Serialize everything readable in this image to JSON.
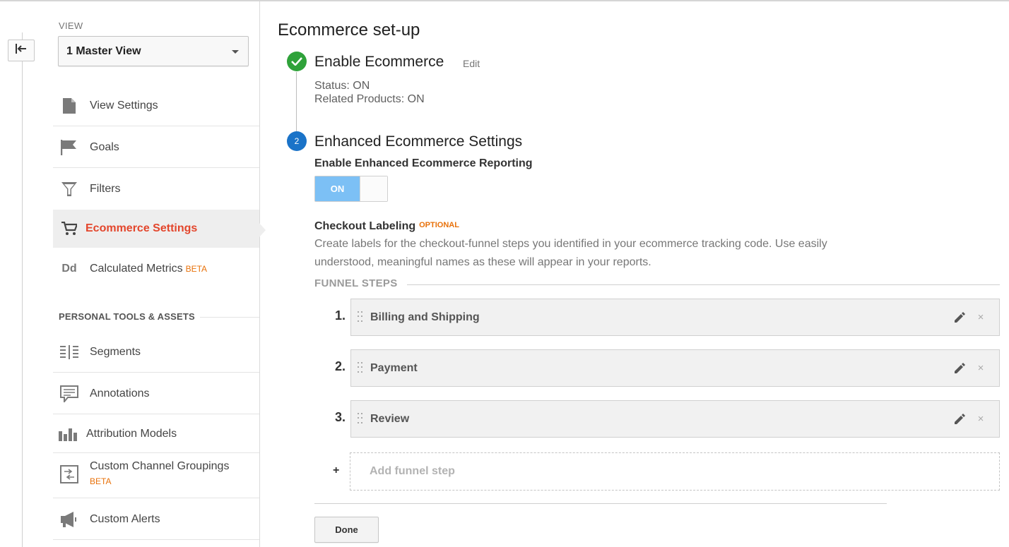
{
  "sidebar": {
    "view_label": "VIEW",
    "view_select": "1 Master View",
    "items": [
      {
        "label": "View Settings",
        "icon": "page-icon"
      },
      {
        "label": "Goals",
        "icon": "flag-icon"
      },
      {
        "label": "Filters",
        "icon": "funnel-icon"
      },
      {
        "label": "Ecommerce Settings",
        "icon": "cart-icon",
        "active": true
      },
      {
        "label": "Calculated Metrics",
        "badge": "BETA",
        "icon": "dd-icon"
      }
    ],
    "section_title": "PERSONAL TOOLS & ASSETS",
    "tools": [
      {
        "label": "Segments",
        "icon": "segments-icon"
      },
      {
        "label": "Annotations",
        "icon": "comment-icon"
      },
      {
        "label": "Attribution Models",
        "icon": "bars-icon"
      },
      {
        "label": "Custom Channel Groupings",
        "badge": "BETA",
        "icon": "channel-icon"
      },
      {
        "label": "Custom Alerts",
        "icon": "megaphone-icon"
      }
    ]
  },
  "main": {
    "title": "Ecommerce set-up",
    "step1": {
      "title": "Enable Ecommerce",
      "edit": "Edit",
      "status": "Status: ON",
      "related": "Related Products: ON"
    },
    "step2": {
      "number": "2",
      "title": "Enhanced Ecommerce Settings",
      "enable_label": "Enable Enhanced Ecommerce Reporting",
      "toggle": "ON",
      "checkout_label": "Checkout Labeling",
      "optional": "OPTIONAL",
      "description": "Create labels for the checkout-funnel steps you identified in your ecommerce tracking code. Use easily understood, meaningful names as these will appear in your reports.",
      "funnel_heading": "FUNNEL STEPS",
      "funnel_steps": [
        {
          "num": "1.",
          "label": "Billing and Shipping"
        },
        {
          "num": "2.",
          "label": "Payment"
        },
        {
          "num": "3.",
          "label": "Review"
        }
      ],
      "plus": "+",
      "add_step": "Add funnel step",
      "close": "×",
      "done": "Done"
    }
  },
  "colors": {
    "active_nav": "#e3462c",
    "beta": "#e8710a",
    "check": "#2fa23a",
    "step_number": "#1a73c8",
    "toggle_on": "#7cc0f5"
  }
}
